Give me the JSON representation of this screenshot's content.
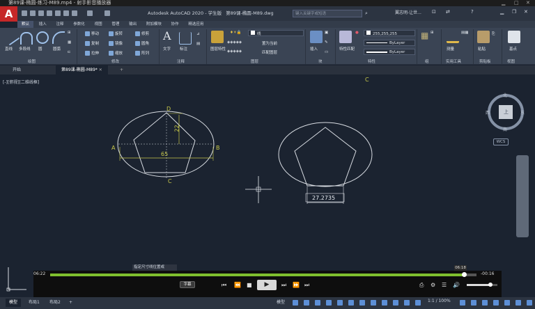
{
  "player": {
    "title": "第89课-椭圆-练习-M89.mp4 - 射手影音播放器",
    "current_time": "06:22",
    "remaining_time": "-00:16",
    "hover_time": "06:18",
    "subtitle_label": "字幕",
    "progress": 0.97,
    "volume": 0.78
  },
  "cad": {
    "app_title": "Autodesk AutoCAD 2020 - 学生版",
    "file_title": "第89课-椭圆-M89.dwg",
    "search_placeholder": "键入关键字或短语",
    "user": "翼志明-让世...",
    "logo": "A",
    "ribbon_tabs": [
      "默认",
      "插入",
      "注释",
      "参数化",
      "视图",
      "管理",
      "输出",
      "附加模块",
      "协作",
      "精选应用"
    ],
    "draw_tools": [
      "直线",
      "多段线",
      "圆",
      "圆弧"
    ],
    "modify_tools": [
      [
        "移动",
        "旋转",
        "修剪"
      ],
      [
        "复制",
        "镜像",
        "圆角"
      ],
      [
        "拉伸",
        "缩放",
        "阵列"
      ]
    ],
    "annotation_tools": [
      "文字",
      "标注"
    ],
    "layer_tools": [
      "图层特性",
      "置为当前",
      "匹配图层"
    ],
    "layer_current": "线",
    "block_tool": "插入",
    "properties": {
      "match": "特性匹配",
      "color": "255,255,255",
      "linetype": "ByLayer",
      "lineweight": "ByLayer"
    },
    "utility_tools": [
      "测量"
    ],
    "clipboard": "粘贴",
    "base": "基点",
    "panel_labels": [
      "绘图",
      "修改",
      "注释",
      "图层",
      "块",
      "特性",
      "组",
      "实用工具",
      "剪贴板",
      "视图"
    ],
    "doc_tabs": [
      "开始",
      "第89课-椭圆-M89*"
    ],
    "view_label": "[-][俯视][二维线框]",
    "cursor_label": "C",
    "compass": {
      "n": "北",
      "s": "南",
      "e": "东",
      "w": "西",
      "top": "上"
    },
    "wcs": "WCS",
    "drawing": {
      "point_labels": [
        "D",
        "A",
        "B",
        "C"
      ],
      "dim_vertical": "22",
      "dim_horizontal": "65",
      "dim_result": "27.2735"
    },
    "status_tooltip": "指定尺寸线位置或",
    "layout_tabs": [
      "模型",
      "布局1",
      "布局2"
    ],
    "model_label": "模型",
    "scale": "1:1 / 100%"
  }
}
